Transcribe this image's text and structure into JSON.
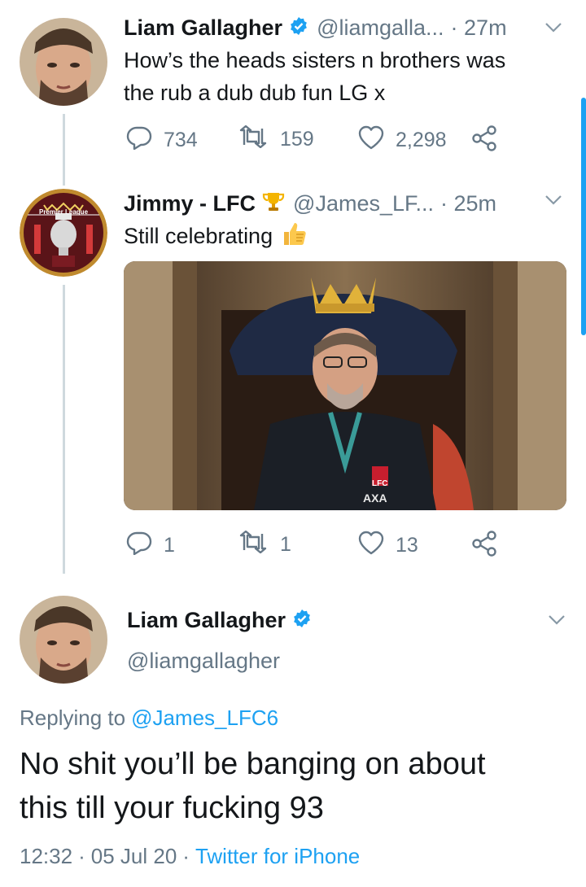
{
  "tweet1": {
    "name": "Liam Gallagher",
    "handle": "@liamgalla...",
    "time": "· 27m",
    "text_line1": "How’s the heads sisters n brothers was",
    "text_line2": "the rub a dub dub fun LG x",
    "replies": "734",
    "retweets": "159",
    "likes": "2,298"
  },
  "tweet2": {
    "name": "Jimmy - LFC",
    "handle": "@James_LF...",
    "time": "· 25m",
    "text": "Still celebrating",
    "replies": "1",
    "retweets": "1",
    "likes": "13",
    "avatar_label": "Premier League",
    "image_text": {
      "sponsor": "AXA",
      "crest": "LFC"
    }
  },
  "tweet3": {
    "name": "Liam Gallagher",
    "handle": "@liamgallagher",
    "replying_prefix": "Replying to",
    "replying_to": "@James_LFC6",
    "text_line1": "No shit you’ll be banging on about",
    "text_line2": "this till your fucking 93",
    "time": "12:32",
    "date": "05 Jul 20",
    "source": "Twitter for iPhone"
  },
  "colors": {
    "accent": "#1da1f2",
    "muted": "#657786",
    "line": "#cfd9de"
  },
  "icons": [
    "verified-badge-icon",
    "trophy-emoji-icon",
    "thumbs-up-emoji-icon",
    "reply-icon",
    "retweet-icon",
    "like-icon",
    "share-icon",
    "chevron-down-icon"
  ]
}
